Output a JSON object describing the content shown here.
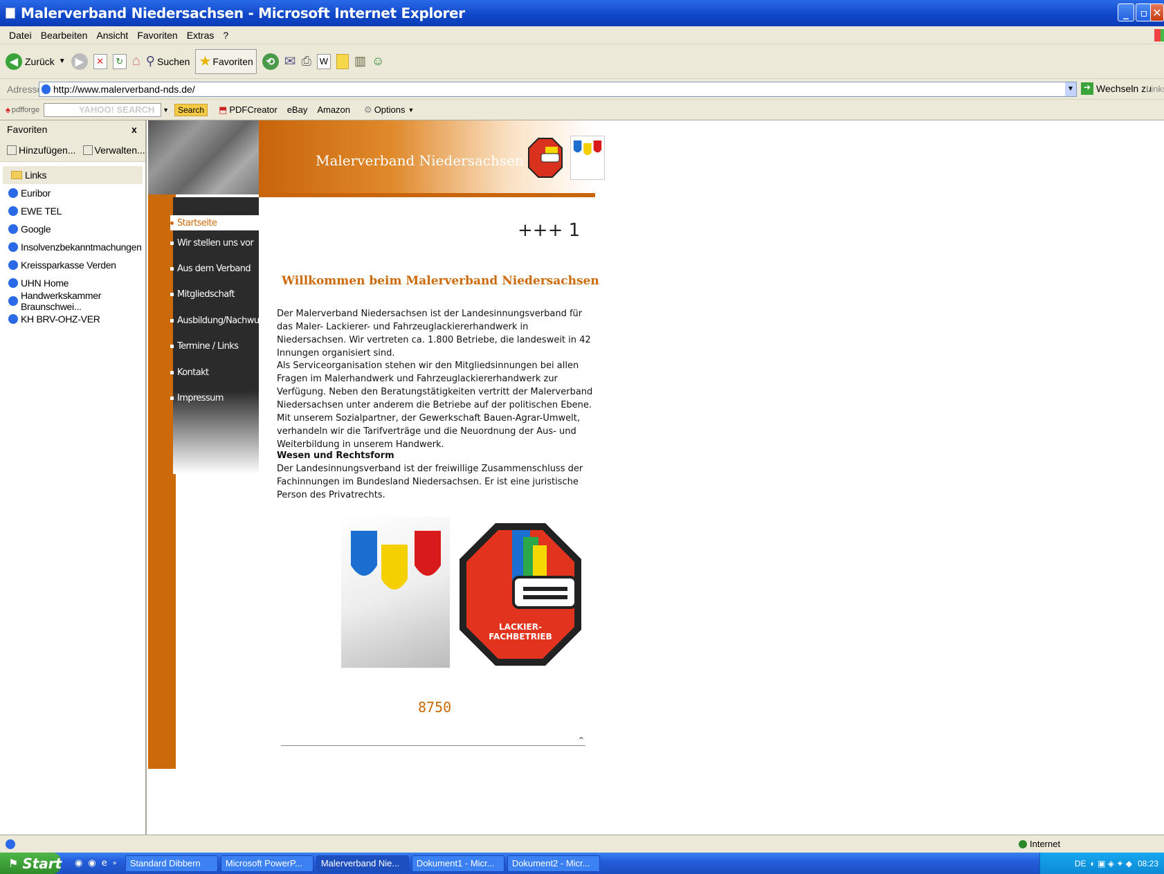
{
  "window": {
    "title": "Malerverband Niedersachsen - Microsoft Internet Explorer"
  },
  "menu": [
    "Datei",
    "Bearbeiten",
    "Ansicht",
    "Favoriten",
    "Extras",
    "?"
  ],
  "toolbar": {
    "back": "Zurück",
    "search": "Suchen",
    "favorites": "Favoriten"
  },
  "address": {
    "label": "Adresse",
    "url": "http://www.malerverband-nds.de/",
    "go": "Wechseln zu",
    "links": "Links"
  },
  "pdfbar": {
    "brand": "pdfforge",
    "search_placeholder": "YAHOO! SEARCH",
    "search_btn": "Search",
    "pdfcreator": "PDFCreator",
    "ebay": "eBay",
    "amazon": "Amazon",
    "options": "Options"
  },
  "favorites": {
    "title": "Favoriten",
    "close": "x",
    "add": "Hinzufügen...",
    "manage": "Verwalten...",
    "folder": "Links",
    "items": [
      "Euribor",
      "EWE TEL",
      "Google",
      "Insolvenzbekanntmachungen",
      "Kreissparkasse Verden",
      "UHN Home",
      "Handwerkskammer Braunschwei...",
      "KH BRV-OHZ-VER"
    ]
  },
  "site": {
    "banner_title": "Malerverband Niedersachsen",
    "nav": [
      "Startseite",
      "Wir stellen uns vor",
      "Aus dem Verband",
      "Mitgliedschaft",
      "Ausbildung/Nachwuchs",
      "Termine / Links",
      "Kontakt",
      "Impressum"
    ],
    "active_nav": "Startseite",
    "ticker": "+++ 1",
    "welcome": "Willkommen beim Malerverband Niedersachsen",
    "p1": "Der Malerverband Niedersachsen ist der Landesinnungsverband für das Maler- Lackierer- und Fahrzeuglackiererhandwerk in Niedersachsen. Wir vertreten ca. 1.800 Betriebe, die landesweit in 42 Innungen organisiert sind.",
    "p2": "Als Serviceorganisation stehen wir den Mitgliedsinnungen bei allen Fragen im Malerhandwerk und Fahrzeuglackiererhandwerk zur Verfügung. Neben den Beratungstätigkeiten vertritt der Malerverband Niedersachsen unter anderem die Betriebe auf der politischen Ebene. Mit unserem Sozialpartner, der Gewerkschaft Bauen-Agrar-Umwelt, verhandeln wir die Tarifverträge und die Neuordnung der Aus- und Weiterbildung in unserem Handwerk.",
    "h_wesen": "Wesen und Rechtsform",
    "p3": "Der Landesinnungsverband ist der freiwillige Zusammenschluss der Fachinnungen im Bundesland Niedersachsen. Er ist eine juristische Person des Privatrechts.",
    "logo_text_1": "LACKIER-",
    "logo_text_2": "FACHBETRIEB",
    "counter": "8750"
  },
  "status": {
    "zone": "Internet"
  },
  "taskbar": {
    "start": "Start",
    "tasks": [
      "Standard Dibbern",
      "Microsoft PowerP...",
      "Malerverband Nie...",
      "Dokument1 - Micr...",
      "Dokument2 - Micr..."
    ],
    "active_task": "Malerverband Nie...",
    "lang": "DE",
    "clock": "08:23"
  },
  "colors": {
    "accent": "#cc6a0a",
    "xp_blue": "#245edb",
    "chrome": "#ece9d8"
  }
}
